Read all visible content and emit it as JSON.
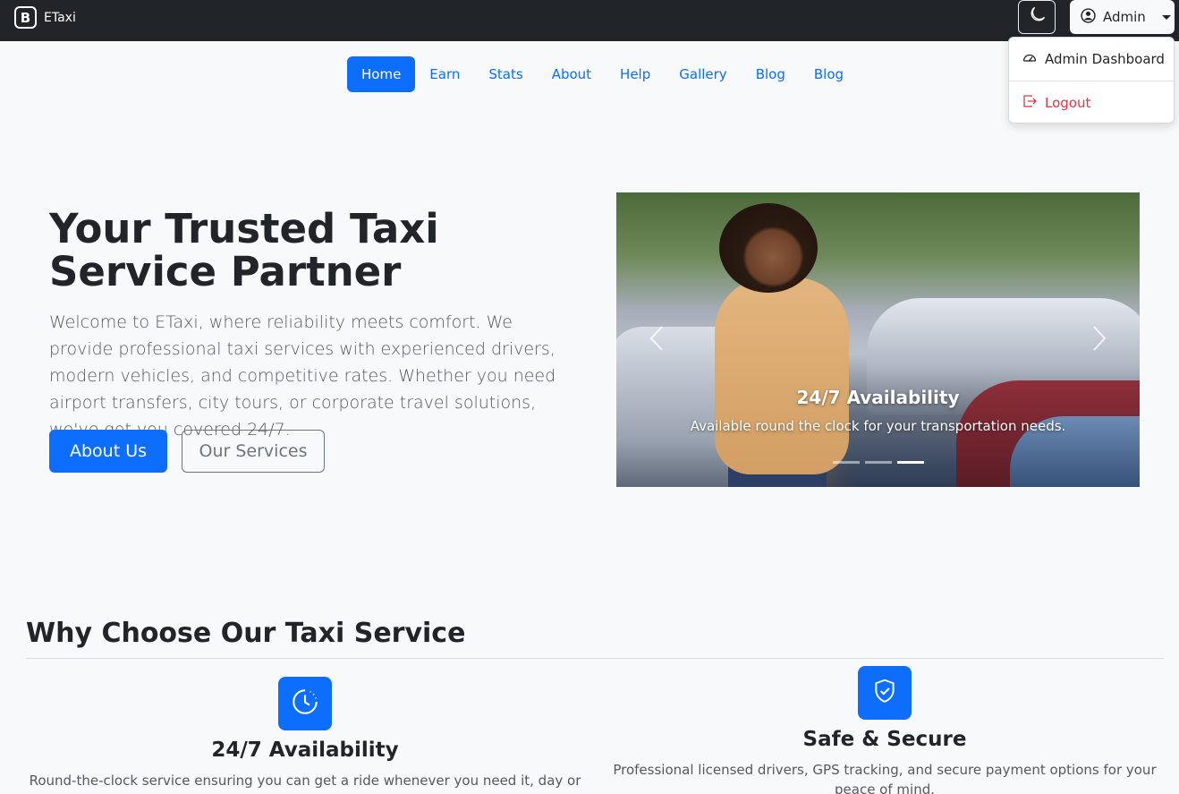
{
  "brand": {
    "logo_letter": "B",
    "name": "ETaxi"
  },
  "header": {
    "theme_toggle_icon": "moon-icon",
    "user_menu": {
      "icon": "person-circle-icon",
      "label": "Admin"
    }
  },
  "dropdown": {
    "items": [
      {
        "icon": "speedometer-icon",
        "label": "Admin Dashboard"
      },
      {
        "icon": "logout-icon",
        "label": "Logout",
        "color": "#dc3545"
      }
    ]
  },
  "nav": {
    "items": [
      "Home",
      "Earn",
      "Stats",
      "About",
      "Help",
      "Gallery",
      "Blog",
      "Blog"
    ],
    "active": "Home"
  },
  "hero": {
    "title": "Your Trusted Taxi Service Partner",
    "text": "Welcome to ETaxi, where reliability meets comfort. We provide professional taxi services with experienced drivers, modern vehicles, and competitive rates. Whether you need airport transfers, city tours, or corporate travel solutions, we've got you covered 24/7.",
    "primary_button": "About Us",
    "secondary_button": "Our Services"
  },
  "carousel": {
    "caption_title": "24/7 Availability",
    "caption_text": "Available round the clock for your transportation needs.",
    "slide_count": 3,
    "active_index": 2
  },
  "features": {
    "section_title": "Why Choose Our Taxi Service",
    "items": [
      {
        "icon": "clock-icon",
        "title": "24/7 Availability",
        "text": "Round-the-clock service ensuring you can get a ride whenever you need it, day or night."
      },
      {
        "icon": "shield-check-icon",
        "title": "Safe & Secure",
        "text": "Professional licensed drivers, GPS tracking, and secure payment options for your peace of mind."
      }
    ]
  },
  "colors": {
    "primary": "#0d6efd",
    "navbar": "#212529",
    "danger": "#dc3545",
    "background": "#f8f9fa"
  }
}
